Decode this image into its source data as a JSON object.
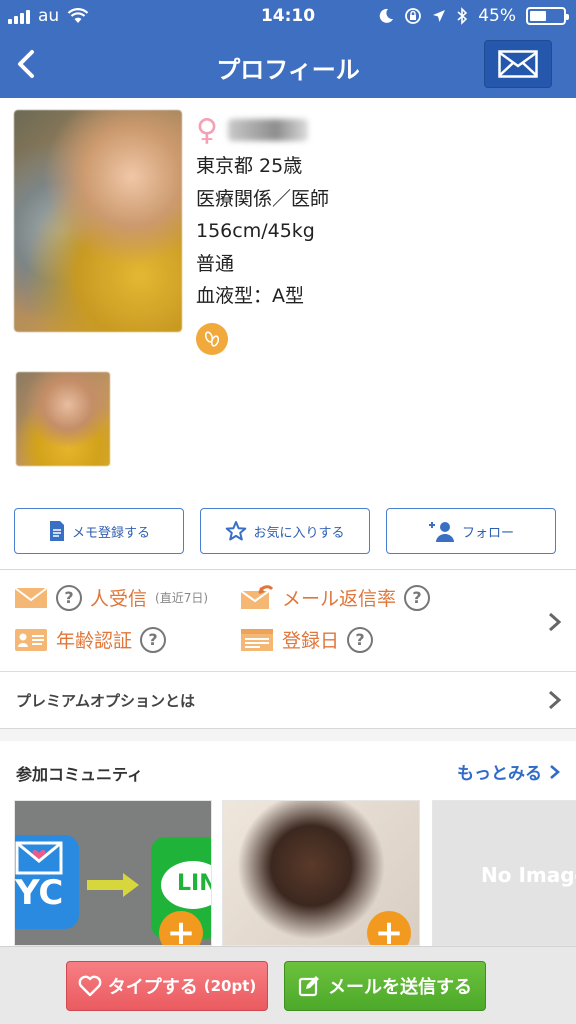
{
  "status_bar": {
    "carrier": "au",
    "time": "14:10",
    "battery_percent": "45%",
    "battery_level": 0.45,
    "icons": [
      "signal-icon",
      "wifi-icon",
      "moon-icon",
      "rotation-lock-icon",
      "location-icon",
      "bluetooth-icon",
      "battery-icon"
    ]
  },
  "navbar": {
    "title": "プロフィール",
    "back_icon": "chevron-left-icon",
    "mail_icon": "envelope-icon"
  },
  "profile": {
    "gender_symbol": "♀",
    "location_age": "東京都  25歳",
    "occupation": "医療関係／医師",
    "body": "156cm/45kg",
    "body_type": "普通",
    "blood_type": "血液型：A型",
    "badge_icon": "footprints-icon"
  },
  "actions": {
    "memo": "メモ登録する",
    "favorite": "お気に入りする",
    "follow": "フォロー"
  },
  "stats": {
    "received_label": "人受信",
    "received_sub": "(直近7日)",
    "reply_rate_label": "メール返信率",
    "age_verify_label": "年齢認証",
    "registered_label": "登録日",
    "question_mark": "?"
  },
  "premium": {
    "label": "プレミアムオプションとは"
  },
  "community": {
    "label": "参加コミュニティ",
    "more": "もっとみる",
    "card1_text_left": "YC",
    "card1_text_right": "LIN",
    "card3_text": "No Image",
    "plus": "+"
  },
  "bottom": {
    "type_label": "タイプする",
    "type_cost": "(20pt)",
    "send_label": "メールを送信する"
  },
  "colors": {
    "header_blue": "#3f6fc0",
    "accent_orange": "#e0763a",
    "link_blue": "#2f6cc8",
    "type_pink": "#ea5b60",
    "send_green": "#4da92a"
  }
}
